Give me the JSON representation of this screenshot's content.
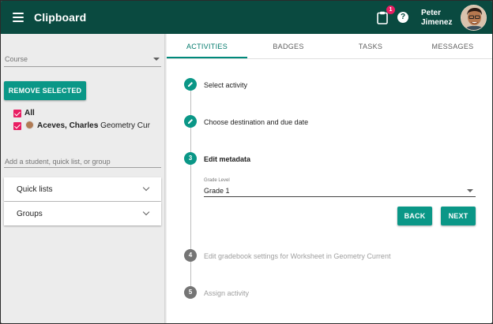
{
  "header": {
    "title": "Clipboard",
    "notification_count": "1",
    "help_symbol": "?",
    "user_first": "Peter",
    "user_last": "Jimenez",
    "icons": [
      "menu-icon",
      "clipboard-icon",
      "help-icon"
    ],
    "color": "#0a4a40"
  },
  "sidebar": {
    "course_label": "Course",
    "remove_button": "REMOVE SELECTED",
    "all_label": "All",
    "student_name": "Aceves, Charles",
    "student_class": "- Geometry Cur",
    "add_placeholder": "Add a student, quick list, or group",
    "panels": [
      {
        "label": "Quick lists"
      },
      {
        "label": "Groups"
      }
    ]
  },
  "tabs": [
    {
      "label": "ACTIVITIES",
      "active": true
    },
    {
      "label": "BADGES",
      "active": false
    },
    {
      "label": "TASKS",
      "active": false
    },
    {
      "label": "MESSAGES",
      "active": false
    }
  ],
  "steps": [
    {
      "number": "",
      "label": "Select activity",
      "state": "done"
    },
    {
      "number": "",
      "label": "Choose destination and due date",
      "state": "done"
    },
    {
      "number": "3",
      "label": "Edit metadata",
      "state": "active"
    },
    {
      "number": "4",
      "label": "Edit gradebook settings for Worksheet in Geometry Current",
      "state": "pending"
    },
    {
      "number": "5",
      "label": "Assign activity",
      "state": "pending"
    }
  ],
  "metadata": {
    "grade_caption": "Grade Level",
    "grade_value": "Grade 1",
    "back_button": "BACK",
    "next_button": "NEXT"
  },
  "colors": {
    "accent": "#0a9787",
    "checkbox": "#e91e63",
    "badge": "#e91e63"
  }
}
